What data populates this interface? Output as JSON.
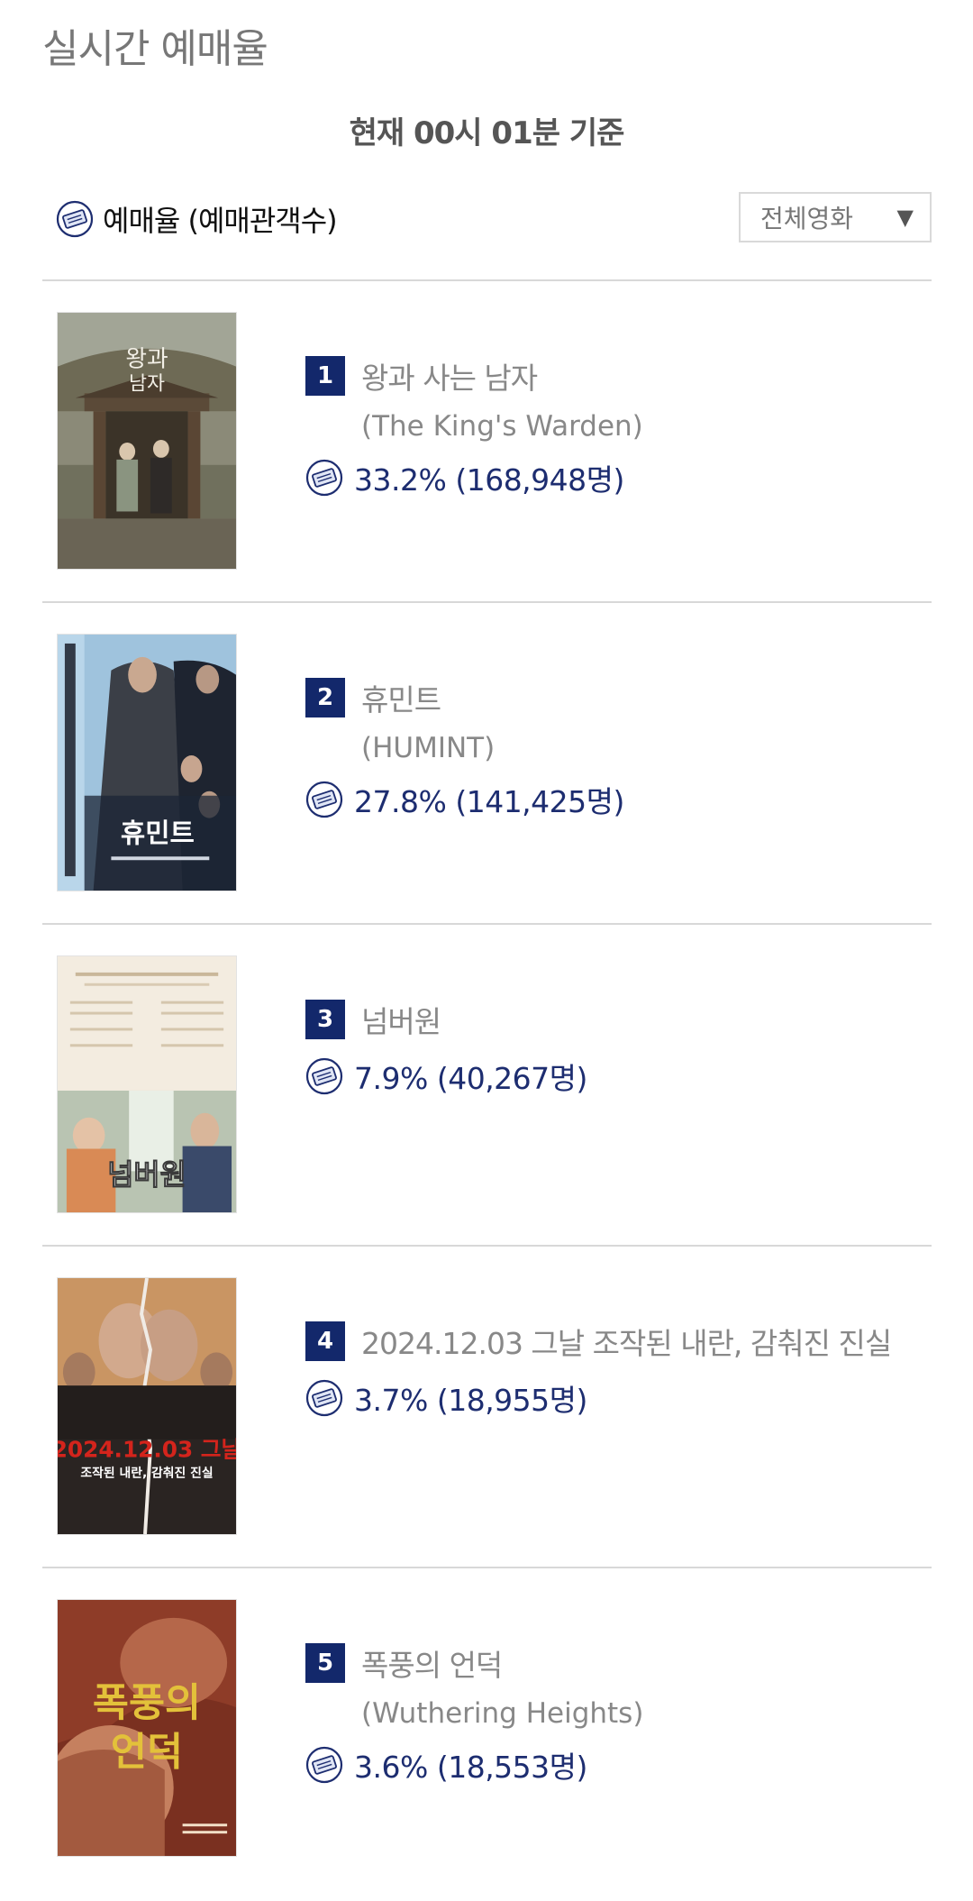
{
  "page": {
    "title": "실시간 예매율",
    "basis": "현재  00시 01분   기준",
    "legend": "예매율 (예매관객수)",
    "filter": {
      "selected": "전체영화"
    }
  },
  "colors": {
    "rank_badge": "#13286b",
    "rate_text": "#1d2d70",
    "divider": "#d8d8d8",
    "muted_text": "#888888"
  },
  "movies": [
    {
      "rank": "1",
      "title": "왕과 사는 남자",
      "title_en": "(The King's Warden)",
      "rate": "33.2% (168,948명)"
    },
    {
      "rank": "2",
      "title": "휴민트",
      "title_en": "(HUMINT)",
      "rate": "27.8% (141,425명)"
    },
    {
      "rank": "3",
      "title": "넘버원",
      "title_en": "",
      "rate": "7.9% (40,267명)"
    },
    {
      "rank": "4",
      "title": "2024.12.03 그날 조작된 내란, 감춰진 진실",
      "title_en": "",
      "rate": "3.7% (18,955명)"
    },
    {
      "rank": "5",
      "title": "폭풍의 언덕",
      "title_en": "(Wuthering Heights)",
      "rate": "3.6% (18,553명)"
    }
  ]
}
